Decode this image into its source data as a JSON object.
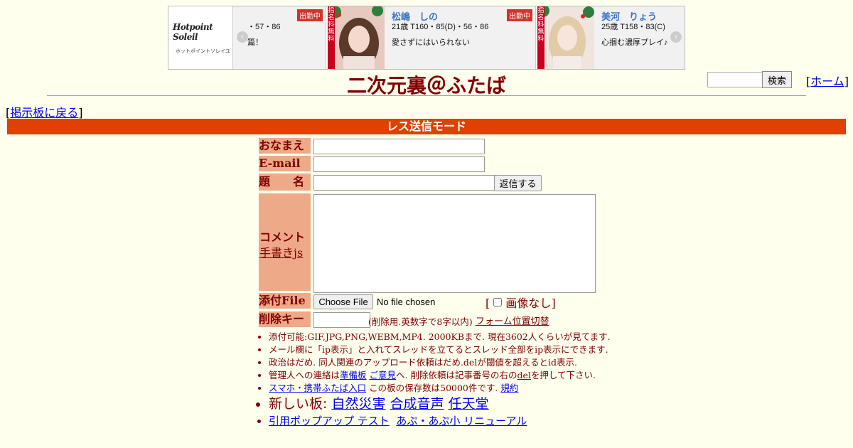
{
  "banner": {
    "logo_text": "Hotpoint Soleil",
    "logo_sub": "ホットポイントソレイユ",
    "prev_arrow": "‹",
    "next_arrow": "›",
    "cards": [
      {
        "name": "",
        "spec": "・57・86",
        "message": "篇！",
        "badge": "出勤中"
      },
      {
        "name": "松嶋　しの",
        "spec": "21歳 T160・85(D)・56・86",
        "message": "愛さずにはいられない",
        "badge": "出勤中",
        "ribbon": "指名料無料"
      },
      {
        "name": "美河　りょう",
        "spec": "25歳 T158・83(C)",
        "message": "心掴む濃厚プレイ♪",
        "ribbon": "指名料無料"
      }
    ]
  },
  "search": {
    "placeholder": "",
    "button_label": "検索"
  },
  "home": {
    "open": "[",
    "label": "ホーム",
    "close": "]"
  },
  "title": "二次元裏＠ふたば",
  "back": {
    "open": "[",
    "label": "掲示板に戻る",
    "close": "]"
  },
  "mode_bar": "レス送信モード",
  "form": {
    "name_label": "おなまえ",
    "email_label": "E-mail",
    "subject_label": "題　　名",
    "reply_button": "返信する",
    "comment_label": "コメント",
    "handwrite_link": "手書きjs",
    "file_label": "添付File",
    "choose_file": "Choose File",
    "no_file": "No file chosen",
    "no_image": "画像なし",
    "delkey_label": "削除キー",
    "delkey_note": "(削除用.英数字で8字以内)",
    "form_toggle": "フォーム位置切替"
  },
  "notes": {
    "n1": "添付可能:GIF,JPG,PNG,WEBM,MP4. 2000KBまで. 現在3602人くらいが見てます.",
    "n2": "メール欄に「ip表示」と入れてスレッドを立てるとスレッド全部をip表示にできます.",
    "n3": "政治はだめ. 同人関連のアップロード依頼はだめ.delが閾値を超えるとid表示.",
    "n4a": "管理人への連絡は",
    "n4_link1": "準備板",
    "n4_link2": "ご意見",
    "n4b": "へ. 削除依頼は記事番号の右の",
    "n4_link3": "del",
    "n4c": "を押して下さい.",
    "n5_link": "スマホ・携帯ふたば入口",
    "n5b": " この板の保存数は50000件です. ",
    "n5_link2": "規約",
    "n6a": "新しい板: ",
    "n6_links": [
      "自然災害",
      "合成音声",
      "任天堂"
    ],
    "n7_links": [
      "引用ポップアップ テスト",
      "あぷ・あぷ小 リニューアル"
    ]
  },
  "colors": {
    "accent_bar": "#e04000",
    "label_bg": "#eeaa88",
    "text": "#800000",
    "page_bg": "#ffffee"
  }
}
